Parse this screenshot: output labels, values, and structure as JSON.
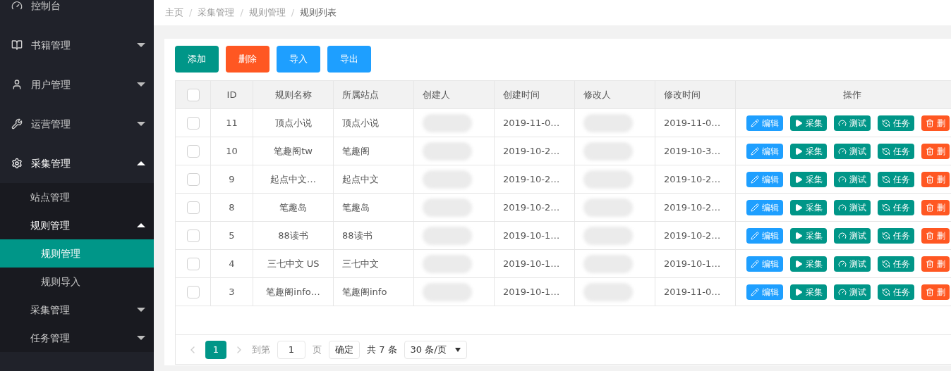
{
  "sidebar": {
    "items": [
      {
        "kind": "link",
        "label": "控制台",
        "selected": false
      },
      {
        "kind": "group",
        "label": "书籍管理",
        "expanded": false
      },
      {
        "kind": "group",
        "label": "用户管理",
        "expanded": false
      },
      {
        "kind": "group",
        "label": "运营管理",
        "expanded": false
      },
      {
        "kind": "group",
        "label": "采集管理",
        "expanded": true,
        "children": [
          {
            "kind": "link",
            "label": "站点管理",
            "selected": false
          },
          {
            "kind": "group",
            "label": "规则管理",
            "expanded": true,
            "children": [
              {
                "kind": "link",
                "label": "规则管理",
                "selected": true
              },
              {
                "kind": "link",
                "label": "规则导入",
                "selected": false
              }
            ]
          },
          {
            "kind": "group",
            "label": "采集管理",
            "expanded": false
          },
          {
            "kind": "group",
            "label": "任务管理",
            "expanded": false
          }
        ]
      }
    ]
  },
  "breadcrumb": {
    "items": [
      "主页",
      "采集管理",
      "规则管理",
      "规则列表"
    ],
    "separators": [
      "/",
      "/",
      "/"
    ]
  },
  "toolbar": [
    {
      "label": "添加",
      "kind": "primary"
    },
    {
      "label": "删除",
      "kind": "danger"
    },
    {
      "label": "导入",
      "kind": "normal"
    },
    {
      "label": "导出",
      "kind": "normal"
    }
  ],
  "table": {
    "header_checked": false,
    "columns": [
      "ID",
      "规则名称",
      "所属站点",
      "创建人",
      "创建时间",
      "修改人",
      "修改时间",
      "操作"
    ],
    "rows": [
      {
        "checked": false,
        "id": "11",
        "name": "顶点小说",
        "site": "顶点小说",
        "created": "2019-11-0…",
        "modified": "2019-11-0…",
        "actions": [
          {
            "kind": "edit",
            "label": "编辑"
          },
          {
            "kind": "collect",
            "label": "采集"
          },
          {
            "kind": "test",
            "label": "测试"
          },
          {
            "kind": "task",
            "label": "任务"
          },
          {
            "kind": "delete",
            "label": "删"
          }
        ]
      },
      {
        "checked": false,
        "id": "10",
        "name": "笔趣阁tw",
        "site": "笔趣阁",
        "created": "2019-10-2…",
        "modified": "2019-10-3…",
        "actions": [
          {
            "kind": "edit",
            "label": "编辑"
          },
          {
            "kind": "collect",
            "label": "采集"
          },
          {
            "kind": "test",
            "label": "测试"
          },
          {
            "kind": "task",
            "label": "任务"
          },
          {
            "kind": "delete",
            "label": "删"
          }
        ]
      },
      {
        "checked": false,
        "id": "9",
        "name": "起点中文…",
        "site": "起点中文",
        "created": "2019-10-2…",
        "modified": "2019-10-2…",
        "actions": [
          {
            "kind": "edit",
            "label": "编辑"
          },
          {
            "kind": "collect",
            "label": "采集"
          },
          {
            "kind": "test",
            "label": "测试"
          },
          {
            "kind": "task",
            "label": "任务"
          },
          {
            "kind": "delete",
            "label": "删"
          }
        ]
      },
      {
        "checked": false,
        "id": "8",
        "name": "笔趣岛",
        "site": "笔趣岛",
        "created": "2019-10-2…",
        "modified": "2019-10-2…",
        "actions": [
          {
            "kind": "edit",
            "label": "编辑"
          },
          {
            "kind": "collect",
            "label": "采集"
          },
          {
            "kind": "test",
            "label": "测试"
          },
          {
            "kind": "task",
            "label": "任务"
          },
          {
            "kind": "delete",
            "label": "删"
          }
        ]
      },
      {
        "checked": false,
        "id": "5",
        "name": "88读书",
        "site": "88读书",
        "created": "2019-10-1…",
        "modified": "2019-10-2…",
        "actions": [
          {
            "kind": "edit",
            "label": "编辑"
          },
          {
            "kind": "collect",
            "label": "采集"
          },
          {
            "kind": "test",
            "label": "测试"
          },
          {
            "kind": "task",
            "label": "任务"
          },
          {
            "kind": "delete",
            "label": "删"
          }
        ]
      },
      {
        "checked": false,
        "id": "4",
        "name": "三七中文 US",
        "site": "三七中文",
        "created": "2019-10-1…",
        "modified": "2019-10-1…",
        "actions": [
          {
            "kind": "edit",
            "label": "编辑"
          },
          {
            "kind": "collect",
            "label": "采集"
          },
          {
            "kind": "test",
            "label": "测试"
          },
          {
            "kind": "task",
            "label": "任务"
          },
          {
            "kind": "delete",
            "label": "删"
          }
        ]
      },
      {
        "checked": false,
        "id": "3",
        "name": "笔趣阁info…",
        "site": "笔趣阁info",
        "created": "2019-10-1…",
        "modified": "2019-11-0…",
        "actions": [
          {
            "kind": "edit",
            "label": "编辑"
          },
          {
            "kind": "collect",
            "label": "采集"
          },
          {
            "kind": "test",
            "label": "测试"
          },
          {
            "kind": "task",
            "label": "任务"
          },
          {
            "kind": "delete",
            "label": "删"
          }
        ]
      }
    ]
  },
  "pagination": {
    "prev_disabled": true,
    "pages": [
      {
        "label": "1",
        "selected": true
      }
    ],
    "next_disabled": true,
    "goto_label": "到第",
    "goto_value": "1",
    "page_unit": "页",
    "confirm": "确定",
    "total": "共 7 条",
    "page_size": "30 条/页"
  }
}
